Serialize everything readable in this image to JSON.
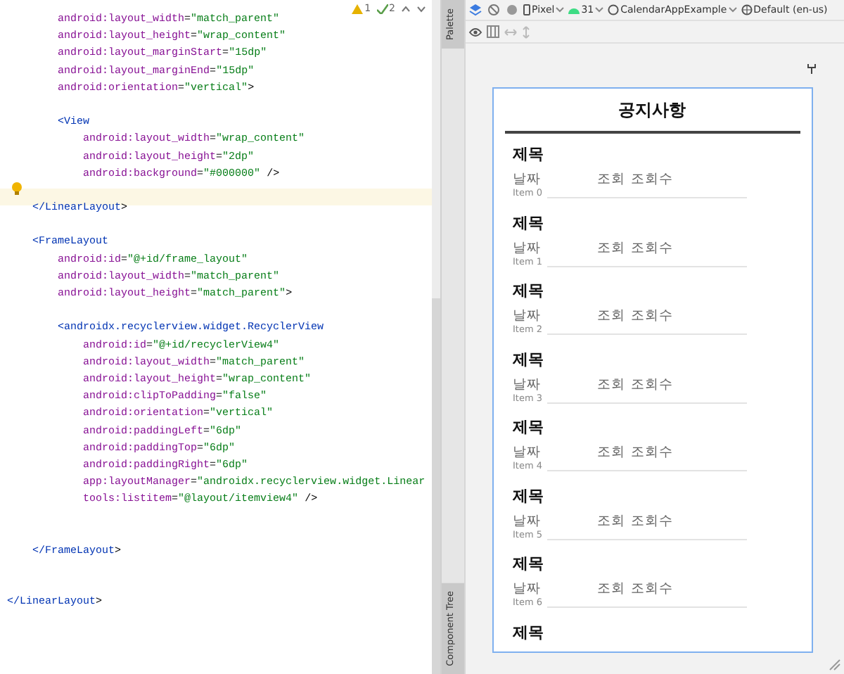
{
  "editor": {
    "inspections": {
      "warnings": "1",
      "weak_warnings": "2"
    },
    "lines": [
      {
        "text": "        android:layout_width=\"match_parent\"",
        "highlighted": false
      },
      {
        "text": "        android:layout_height=\"wrap_content\"",
        "highlighted": false
      },
      {
        "text": "        android:layout_marginStart=\"15dp\"",
        "highlighted": false
      },
      {
        "text": "        android:layout_marginEnd=\"15dp\"",
        "highlighted": false
      },
      {
        "text": "        android:orientation=\"vertical\">",
        "highlighted": false
      },
      {
        "highlighted": false
      },
      {
        "text": "        <View",
        "highlighted": false
      },
      {
        "text": "            android:layout_width=\"wrap_content\"",
        "highlighted": false
      },
      {
        "text": "            android:layout_height=\"2dp\"",
        "highlighted": false
      },
      {
        "text": "            android:background=\"#000000\" />",
        "highlighted": false
      },
      {
        "highlighted": false
      },
      {
        "text": "    </LinearLayout>",
        "highlighted": true
      },
      {
        "highlighted": false
      },
      {
        "text": "    <FrameLayout",
        "highlighted": false
      },
      {
        "text": "        android:id=\"@+id/frame_layout\"",
        "highlighted": false
      },
      {
        "text": "        android:layout_width=\"match_parent\"",
        "highlighted": false
      },
      {
        "text": "        android:layout_height=\"match_parent\">",
        "highlighted": false
      },
      {
        "highlighted": false
      },
      {
        "text": "        <androidx.recyclerview.widget.RecyclerView",
        "highlighted": false
      },
      {
        "text": "            android:id=\"@+id/recyclerView4\"",
        "highlighted": false
      },
      {
        "text": "            android:layout_width=\"match_parent\"",
        "highlighted": false
      },
      {
        "text": "            android:layout_height=\"wrap_content\"",
        "highlighted": false
      },
      {
        "text": "            android:clipToPadding=\"false\"",
        "highlighted": false
      },
      {
        "text": "            android:orientation=\"vertical\"",
        "highlighted": false
      },
      {
        "text": "            android:paddingLeft=\"6dp\"",
        "highlighted": false
      },
      {
        "text": "            android:paddingTop=\"6dp\"",
        "highlighted": false
      },
      {
        "text": "            android:paddingRight=\"6dp\"",
        "highlighted": false
      },
      {
        "text": "            app:layoutManager=\"androidx.recyclerview.widget.Linear",
        "highlighted": false
      },
      {
        "text": "            tools:listitem=\"@layout/itemview4\" />",
        "highlighted": false
      },
      {
        "highlighted": false
      },
      {
        "highlighted": false
      },
      {
        "text": "    </FrameLayout>",
        "highlighted": false
      },
      {
        "highlighted": false
      },
      {
        "highlighted": false
      },
      {
        "text": "</LinearLayout>",
        "highlighted": false
      }
    ]
  },
  "side_tabs": [
    {
      "label": "Palette"
    },
    {
      "label": "Component Tree"
    }
  ],
  "toolbar": {
    "device": "Pixel",
    "api": "31",
    "theme": "CalendarAppExample",
    "locale": "Default (en-us)"
  },
  "preview": {
    "title": "공지사항",
    "items": [
      {
        "title": "제목",
        "date": "날짜",
        "views_label": "조회",
        "views": "조회수",
        "index": "Item 0"
      },
      {
        "title": "제목",
        "date": "날짜",
        "views_label": "조회",
        "views": "조회수",
        "index": "Item 1"
      },
      {
        "title": "제목",
        "date": "날짜",
        "views_label": "조회",
        "views": "조회수",
        "index": "Item 2"
      },
      {
        "title": "제목",
        "date": "날짜",
        "views_label": "조회",
        "views": "조회수",
        "index": "Item 3"
      },
      {
        "title": "제목",
        "date": "날짜",
        "views_label": "조회",
        "views": "조회수",
        "index": "Item 4"
      },
      {
        "title": "제목",
        "date": "날짜",
        "views_label": "조회",
        "views": "조회수",
        "index": "Item 5"
      },
      {
        "title": "제목",
        "date": "날짜",
        "views_label": "조회",
        "views": "조회수",
        "index": "Item 6"
      },
      {
        "title": "제목"
      }
    ]
  }
}
